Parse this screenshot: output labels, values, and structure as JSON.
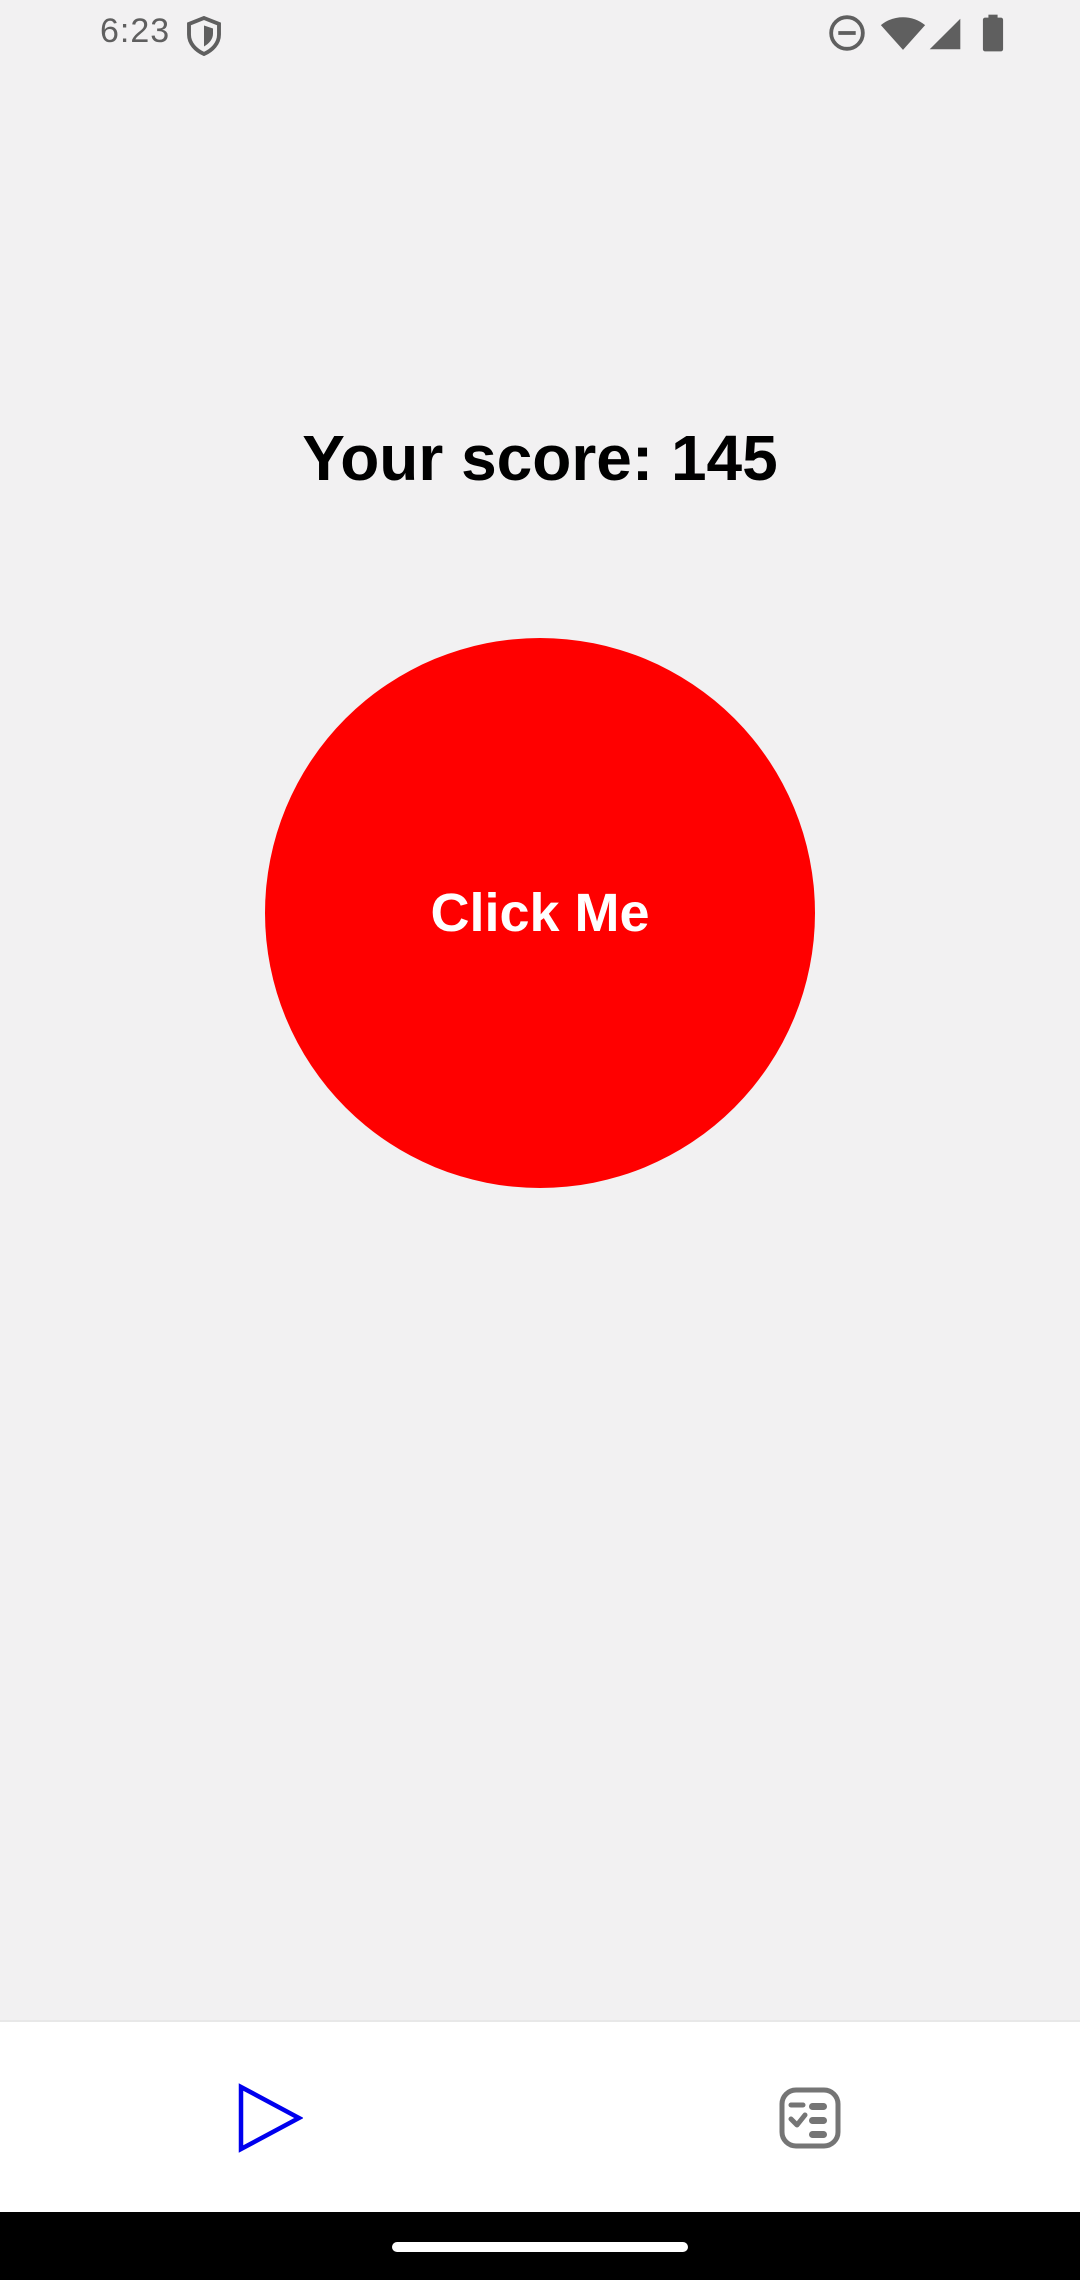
{
  "status_bar": {
    "time": "6:23",
    "icons": [
      "shield-icon",
      "do-not-disturb-icon",
      "wifi-icon",
      "cellular-signal-icon",
      "battery-icon"
    ]
  },
  "main": {
    "score_text": "Your score: 145",
    "button_label": "Click Me",
    "button_color": "#ff0000"
  },
  "bottom_nav": {
    "items": [
      {
        "icon": "play-icon",
        "color": "#0000ee"
      },
      {
        "icon": "checklist-icon",
        "color": "#757575"
      }
    ]
  },
  "colors": {
    "background": "#f2f1f2",
    "nav_background": "#ffffff"
  }
}
